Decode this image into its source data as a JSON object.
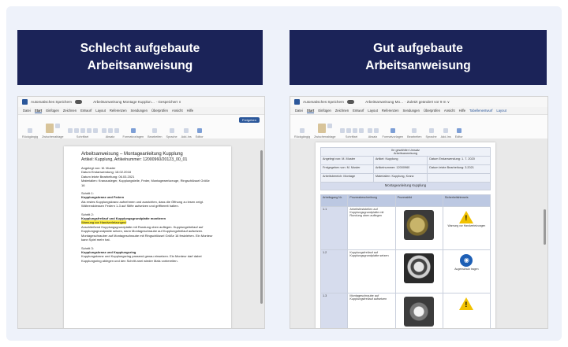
{
  "left": {
    "banner": {
      "line1": "Schlecht aufgebaute",
      "line2": "Arbeitsanweisung"
    },
    "window": {
      "autosave": "Automatisches Speichern",
      "doc_title": "Arbeitsanweisung Montage Kupplun… · Gespeichert ∨",
      "tabs": [
        "Datei",
        "Start",
        "Einfügen",
        "Zeichnen",
        "Entwurf",
        "Layout",
        "Referenzen",
        "Sendungen",
        "Überprüfen",
        "Ansicht",
        "Hilfe"
      ],
      "groups": [
        "Rückgängig",
        "Zwischenablage",
        "Schriftart",
        "Absatz",
        "Formatvorlagen",
        "Bearbeiten",
        "Sprache",
        "Add-Ins",
        "Editor"
      ],
      "share": "Freigeben"
    },
    "doc": {
      "title": "Arbeitsanweisung – Montageanleitung Kupplung",
      "subtitle": "Artikel: Kupplung, Artikelnummer: 12000960/20123_00_01",
      "meta": [
        "Angelegt von: M. Muster",
        "Datum Erstanwendung: 18.02.2018",
        "Datum letzte Bearbeitung: 06.03.2021",
        "Materialien: Kranausleger, Kupplungsteile, Feder, Montagewerkzeuge, Ringschlüssel Größe 16"
      ],
      "s1_label": "Schritt 1:",
      "s1_title": "Kupplungskranz und Federn",
      "s1_text": "Als erstes Kupplungskranz aufnehmen und ausrichten, dass die Öffnung zu lesen zeigt. Währenddessen Federn 1-3 auf Stifte aufsetzen und griffbereit halten.",
      "s2_label": "Schritt 2:",
      "s2_title": "Kupplungsfreilauf und Kupplungsgrundplatte montieren",
      "s2_highlight": "Warnung vor Handverletzungen!",
      "s2_text": "Anschließend Kupplungsgrundplatte mit Rundung oben auflegen. Kupplungsfreilauf auf Kupplungsgrundplatte setzen, dann Montageschraube auf Kupplungsfreilauf aufsetzen. Montageschrauber auf Montageschraube mit Ringschlüssel Größe 16 festziehen. Ein Monteur kann Spiel mehr hat.",
      "s3_label": "Schritt 3:",
      "s3_title": "Kupplungskranz und Kupplungsring",
      "s3_text": "Kupplungskranz und Kupplungsring passend genau einsetzen. Ein Monteur darf dabei Kupplungsring ablegen und den Schritt zwei wieder Mals vorbereiten."
    }
  },
  "right": {
    "banner": {
      "line1": "Gut aufgebaute",
      "line2": "Arbeitsanweisung"
    },
    "window": {
      "autosave": "Automatisches Speichern",
      "doc_title": "Arbeitsanweisung Mo… · Zuletzt geändert vor 9 m ∨",
      "tabs": [
        "Datei",
        "Start",
        "Einfügen",
        "Zeichnen",
        "Entwurf",
        "Layout",
        "Referenzen",
        "Sendungen",
        "Überprüfen",
        "Ansicht",
        "Hilfe",
        "Tabellenentwurf",
        "Layout"
      ],
      "groups": [
        "Rückgängig",
        "Zwischenablage",
        "Schriftart",
        "Absatz",
        "Formatvorlagen",
        "Bearbeiten",
        "Sprache",
        "Add-Ins",
        "Editor"
      ]
    },
    "doc": {
      "header": {
        "company": "Ihr gewählter Umsatz",
        "subtitle": "Arbeitsanweisung",
        "row1": [
          "Angelegt von: M. Muster",
          "Artikel: Kupplung",
          "Datum Erstanwendung: 1. 7. 2020"
        ],
        "row2": [
          "Freigegeben von: M. Muster",
          "Artikelnummer: 12000960",
          "Datum letzte Bearbeitung: 3.2021"
        ],
        "row3": [
          "Arbeitsbereich: Montage",
          "Materialien: Kupplung, Kranz",
          "",
          ""
        ]
      },
      "main_title": "Montageanleitung Kupplung",
      "columns": [
        "Arbeitsgang Nr.",
        "Prozessbeschreibung",
        "Prozessbild",
        "Sicherheitshinweis"
      ],
      "rows": [
        {
          "no": "1.1",
          "desc": "Arbeitsfeststellen auf Kupplungsgrundplatte mit Rundung oben auflegen",
          "safety": "Warnung vor Handverletzungen"
        },
        {
          "no": "1.2",
          "desc": "Kupplungsfreilauf auf Kupplungsgrundplatte setzen",
          "safety": "Augenschutz tragen"
        },
        {
          "no": "1.3",
          "desc": "Montageschraube auf Kupplungsfreilauf aufsetzen",
          "safety": ""
        }
      ]
    }
  }
}
